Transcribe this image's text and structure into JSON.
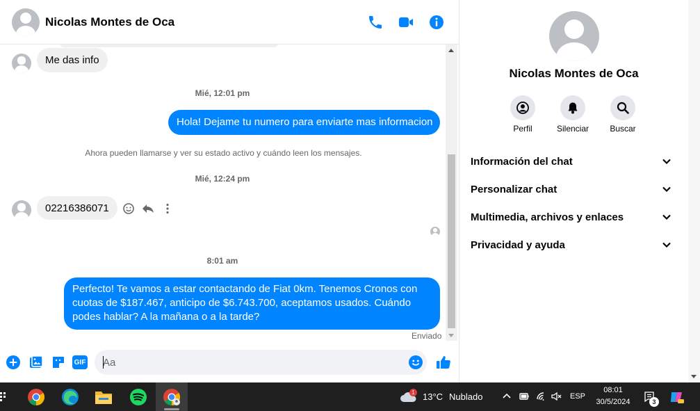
{
  "chat": {
    "contact_name": "Nicolas Montes de Oca",
    "messages": {
      "in_1": "Me das info",
      "ts_1": "Mié, 12:01 pm",
      "out_1": "Hola! Dejame tu numero para enviarte mas informacion",
      "system_note": "Ahora pueden llamarse y ver su estado activo y cuándo leen los mensajes.",
      "ts_2": "Mié, 12:24 pm",
      "in_2": "02216386071",
      "ts_3": "8:01 am",
      "out_2_line1": "Perfecto! Te vamos a estar contactando de Fiat 0km. Tenemos Cronos con",
      "out_2_line2": "cuotas de $187.467, anticipo de $6.743.700, aceptamos usados. Cuándo",
      "out_2_line3": "podes hablar? A la mañana o a la tarde?",
      "status": "Enviado"
    },
    "composer": {
      "placeholder": "Aa",
      "gif_label": "GIF"
    },
    "header_icons": [
      "phone-icon",
      "video-icon",
      "info-icon"
    ]
  },
  "info_panel": {
    "name": "Nicolas Montes de Oca",
    "actions": [
      {
        "label": "Perfil",
        "icon": "profile-icon"
      },
      {
        "label": "Silenciar",
        "icon": "bell-icon"
      },
      {
        "label": "Buscar",
        "icon": "search-icon"
      }
    ],
    "sections": [
      "Información del chat",
      "Personalizar chat",
      "Multimedia, archivos y enlaces",
      "Privacidad y ayuda"
    ]
  },
  "taskbar": {
    "apps": [
      "chrome-icon",
      "edge-icon",
      "file-explorer-icon",
      "spotify-icon",
      "chrome-profile-icon"
    ],
    "weather": {
      "temp": "13°C",
      "condition": "Nublado",
      "badge": "1"
    },
    "language": "ESP",
    "time": "08:01",
    "date": "30/5/2024",
    "notification_count": "3"
  },
  "colors": {
    "accent": "#0084ff",
    "bubble_in": "#f0f0f0",
    "taskbar": "#1f1f1f"
  }
}
